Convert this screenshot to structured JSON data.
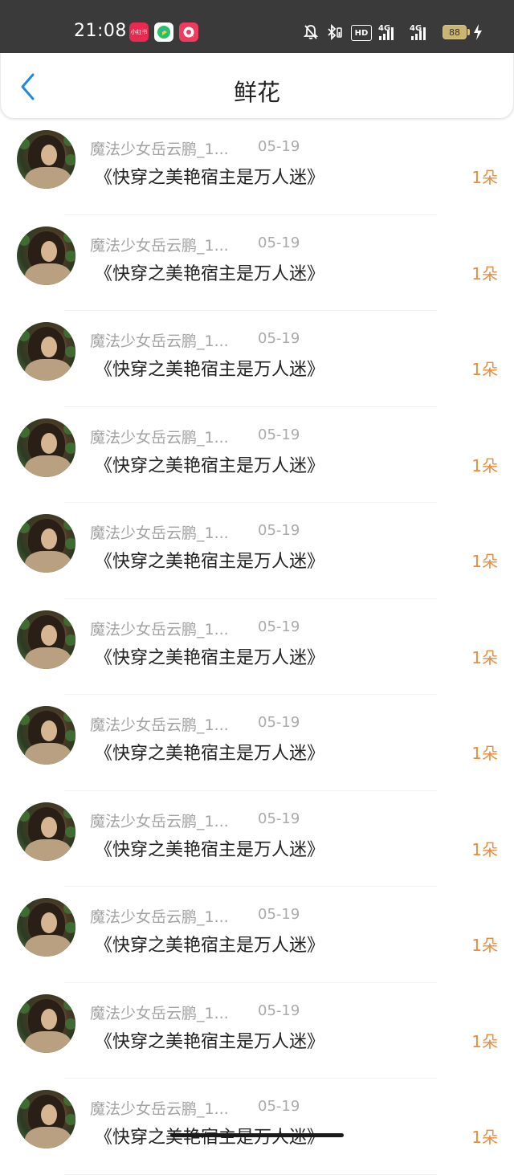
{
  "status_bar": {
    "time": "21:08",
    "apps": [
      {
        "name": "xiaohongshu-icon",
        "label": "小红书"
      },
      {
        "name": "video-app-icon",
        "label": ""
      },
      {
        "name": "chat-app-icon",
        "label": ""
      }
    ],
    "hd_label": "HD",
    "network_1": "4G",
    "network_2": "4G",
    "battery": "88"
  },
  "header": {
    "title": "鲜花",
    "back_icon": "chevron-left-icon",
    "accent": "#1e88e5"
  },
  "colors": {
    "flower_count": "#f08a3a",
    "username": "#a3a3a3",
    "title": "#222222"
  },
  "items": [
    {
      "user": "魔法少女岳云鹏_1...",
      "date": "05-19",
      "book": "《快穿之美艳宿主是万人迷》",
      "count": "1朵"
    },
    {
      "user": "魔法少女岳云鹏_1...",
      "date": "05-19",
      "book": "《快穿之美艳宿主是万人迷》",
      "count": "1朵"
    },
    {
      "user": "魔法少女岳云鹏_1...",
      "date": "05-19",
      "book": "《快穿之美艳宿主是万人迷》",
      "count": "1朵"
    },
    {
      "user": "魔法少女岳云鹏_1...",
      "date": "05-19",
      "book": "《快穿之美艳宿主是万人迷》",
      "count": "1朵"
    },
    {
      "user": "魔法少女岳云鹏_1...",
      "date": "05-19",
      "book": "《快穿之美艳宿主是万人迷》",
      "count": "1朵"
    },
    {
      "user": "魔法少女岳云鹏_1...",
      "date": "05-19",
      "book": "《快穿之美艳宿主是万人迷》",
      "count": "1朵"
    },
    {
      "user": "魔法少女岳云鹏_1...",
      "date": "05-19",
      "book": "《快穿之美艳宿主是万人迷》",
      "count": "1朵"
    },
    {
      "user": "魔法少女岳云鹏_1...",
      "date": "05-19",
      "book": "《快穿之美艳宿主是万人迷》",
      "count": "1朵"
    },
    {
      "user": "魔法少女岳云鹏_1...",
      "date": "05-19",
      "book": "《快穿之美艳宿主是万人迷》",
      "count": "1朵"
    },
    {
      "user": "魔法少女岳云鹏_1...",
      "date": "05-19",
      "book": "《快穿之美艳宿主是万人迷》",
      "count": "1朵"
    },
    {
      "user": "魔法少女岳云鹏_1...",
      "date": "05-19",
      "book": "《快穿之美艳宿主是万人迷》",
      "count": "1朵"
    }
  ]
}
